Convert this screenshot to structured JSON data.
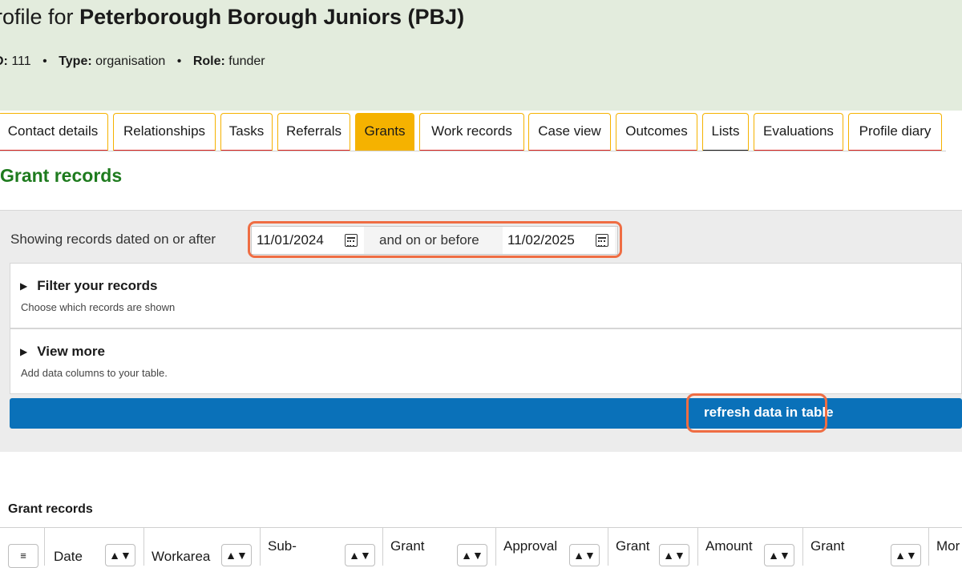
{
  "header": {
    "title_prefix": "rofile for",
    "title_name": "Peterborough Borough Juniors (PBJ)",
    "id_label": "D:",
    "id_value": "111",
    "type_label": "Type:",
    "type_value": "organisation",
    "role_label": "Role:",
    "role_value": "funder",
    "separator": "•"
  },
  "tabs": [
    {
      "label": "Contact details"
    },
    {
      "label": "Relationships"
    },
    {
      "label": "Tasks"
    },
    {
      "label": "Referrals"
    },
    {
      "label": "Grants"
    },
    {
      "label": "Work records"
    },
    {
      "label": "Case view"
    },
    {
      "label": "Outcomes"
    },
    {
      "label": "Lists"
    },
    {
      "label": "Evaluations"
    },
    {
      "label": "Profile diary"
    }
  ],
  "active_tab": "Grants",
  "section_title": "Grant records",
  "date_filter": {
    "label": "Showing records dated on or after",
    "from": "11/01/2024",
    "middle": "and on or before",
    "to": "11/02/2025"
  },
  "filter_panel": {
    "title": "Filter your records",
    "subtitle": "Choose which records are shown"
  },
  "view_more": {
    "title": "View more",
    "subtitle": "Add data columns to your table."
  },
  "refresh_button": "refresh data in table",
  "table": {
    "caption": "Grant records",
    "menu_icon": "≡",
    "sort_icon": "▲▼",
    "columns": [
      {
        "label": "Date"
      },
      {
        "label": "Workarea"
      },
      {
        "label": "Sub-"
      },
      {
        "label": "Grant"
      },
      {
        "label": "Approval"
      },
      {
        "label": "Grant"
      },
      {
        "label": "Amount"
      },
      {
        "label": "Grant"
      },
      {
        "label": "Mor"
      }
    ]
  },
  "colors": {
    "header_bg": "#e3ecdd",
    "accent_yellow": "#f5b200",
    "section_green": "#1e7b1e",
    "refresh_blue": "#0a71b9",
    "highlight": "#ef6d43",
    "tab_underline": "#d9201e"
  }
}
